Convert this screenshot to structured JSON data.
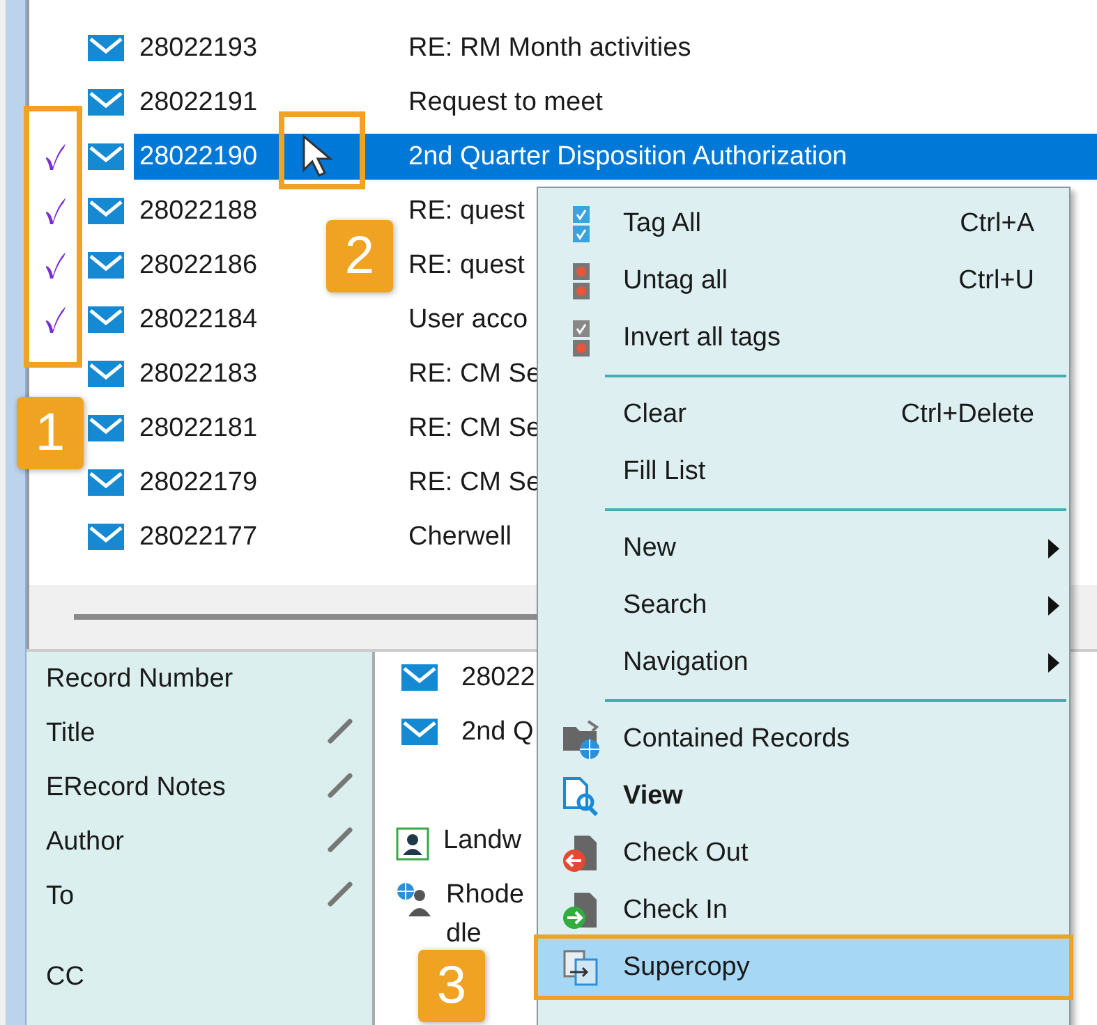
{
  "rows": [
    {
      "number": "28022193",
      "title": "RE: RM Month activities",
      "tagged": false,
      "selected": false
    },
    {
      "number": "28022191",
      "title": "Request to meet",
      "tagged": false,
      "selected": false
    },
    {
      "number": "28022190",
      "title": "2nd Quarter Disposition Authorization",
      "tagged": true,
      "selected": true
    },
    {
      "number": "28022188",
      "title": "RE: quest",
      "tagged": true,
      "selected": false
    },
    {
      "number": "28022186",
      "title": "RE: quest",
      "tagged": true,
      "selected": false
    },
    {
      "number": "28022184",
      "title": "User acco",
      "tagged": true,
      "selected": false
    },
    {
      "number": "28022183",
      "title": "RE: CM Se",
      "tagged": false,
      "selected": false
    },
    {
      "number": "28022181",
      "title": "RE: CM Se",
      "tagged": false,
      "selected": false
    },
    {
      "number": "28022179",
      "title": "RE: CM Se",
      "tagged": false,
      "selected": false
    },
    {
      "number": "28022177",
      "title": "Cherwell",
      "tagged": false,
      "selected": false
    }
  ],
  "properties": [
    {
      "label": "Record Number",
      "editable": false,
      "value": {
        "kind": "record",
        "lines": [
          "28022"
        ]
      }
    },
    {
      "label": "Title",
      "editable": true,
      "value": {
        "kind": "record",
        "lines": [
          "2nd Q"
        ]
      }
    },
    {
      "label": "ERecord Notes",
      "editable": true
    },
    {
      "label": "Author",
      "editable": true,
      "value": {
        "kind": "person",
        "lines": [
          "Landw"
        ]
      }
    },
    {
      "label": "To",
      "editable": true,
      "value": {
        "kind": "group",
        "lines": [
          "Rhode",
          "dle"
        ]
      }
    },
    {
      "label": "CC",
      "editable": false
    }
  ],
  "context_menu": {
    "items": [
      {
        "kind": "command",
        "label": "Tag All",
        "shortcut": "Ctrl+A",
        "submenu": false,
        "default": false,
        "selected": false
      },
      {
        "kind": "command",
        "label": "Untag all",
        "shortcut": "Ctrl+U",
        "submenu": false,
        "default": false,
        "selected": false
      },
      {
        "kind": "command",
        "label": "Invert all tags",
        "submenu": false,
        "default": false,
        "selected": false
      },
      {
        "kind": "separator"
      },
      {
        "kind": "command",
        "label": "Clear",
        "shortcut": "Ctrl+Delete",
        "submenu": false,
        "default": false,
        "selected": false
      },
      {
        "kind": "command",
        "label": "Fill List",
        "submenu": false,
        "default": false,
        "selected": false
      },
      {
        "kind": "separator"
      },
      {
        "kind": "command",
        "label": "New",
        "submenu": true,
        "default": false,
        "selected": false
      },
      {
        "kind": "command",
        "label": "Search",
        "submenu": true,
        "default": false,
        "selected": false
      },
      {
        "kind": "command",
        "label": "Navigation",
        "submenu": true,
        "default": false,
        "selected": false
      },
      {
        "kind": "separator"
      },
      {
        "kind": "command",
        "label": "Contained Records",
        "submenu": false,
        "default": false,
        "selected": false
      },
      {
        "kind": "command",
        "label": "View",
        "submenu": false,
        "default": true,
        "selected": false
      },
      {
        "kind": "command",
        "label": "Check Out",
        "submenu": false,
        "default": false,
        "selected": false
      },
      {
        "kind": "command",
        "label": "Check In",
        "submenu": false,
        "default": false,
        "selected": false
      },
      {
        "kind": "command",
        "label": "Supercopy",
        "submenu": false,
        "default": false,
        "selected": true
      }
    ]
  },
  "callouts": [
    "1",
    "2",
    "3"
  ]
}
